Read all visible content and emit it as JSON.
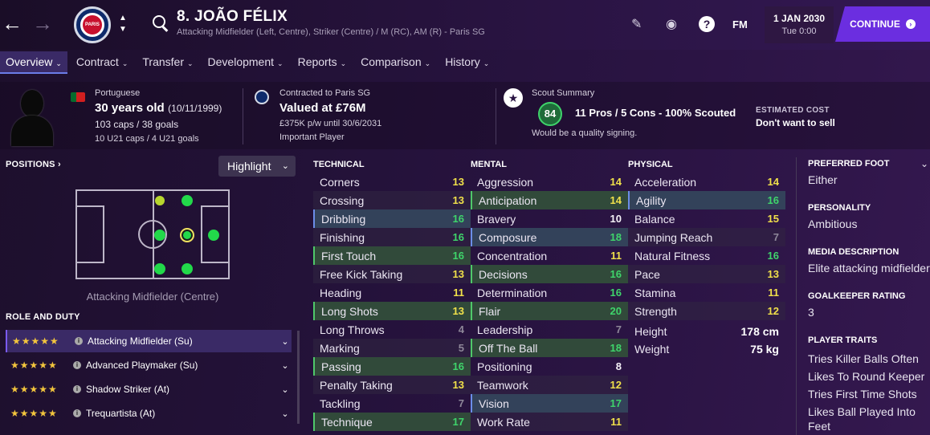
{
  "topbar": {
    "player_name": "8. JOÃO FÉLIX",
    "player_subtitle": "Attacking Midfielder (Left, Centre), Striker (Centre) / M (RC), AM (R) - Paris SG",
    "club_crest_text": "PARIS",
    "fm_label": "FM",
    "date": "1 JAN 2030",
    "time": "Tue 0:00",
    "continue_label": "CONTINUE",
    "icons": [
      "back-arrow-icon",
      "forward-arrow-icon",
      "club-crest-icon",
      "search-icon",
      "pencil-icon",
      "globe-icon",
      "help-icon"
    ]
  },
  "tabs": [
    {
      "label": "Overview",
      "active": true
    },
    {
      "label": "Contract"
    },
    {
      "label": "Transfer"
    },
    {
      "label": "Development"
    },
    {
      "label": "Reports"
    },
    {
      "label": "Comparison"
    },
    {
      "label": "History"
    }
  ],
  "info": {
    "nationality": "Portuguese",
    "age": "30 years old",
    "dob": "(10/11/1999)",
    "caps": "103 caps / 38 goals",
    "u21": "10 U21 caps / 4 U21 goals",
    "contract_label": "Contracted to Paris SG",
    "value": "Valued at £76M",
    "wage": "£375K p/w until 30/6/2031",
    "status": "Important Player",
    "scout_title": "Scout Summary",
    "scout_rating": "84",
    "scout_summary": "11 Pros / 5 Cons - 100% Scouted",
    "scout_note": "Would be a quality signing.",
    "cost_label": "ESTIMATED COST",
    "cost_value": "Don't want to sell"
  },
  "positions": {
    "title": "POSITIONS",
    "highlight_label": "Highlight",
    "position_label": "Attacking Midfielder (Centre)"
  },
  "roles": {
    "title": "ROLE AND DUTY",
    "items": [
      {
        "stars": "★★★★★",
        "name": "Attacking Midfielder (Su)"
      },
      {
        "stars": "★★★★★",
        "name": "Advanced Playmaker (Su)"
      },
      {
        "stars": "★★★★★",
        "name": "Shadow Striker (At)"
      },
      {
        "stars": "★★★★★",
        "name": "Trequartista (At)"
      }
    ]
  },
  "technical": {
    "title": "TECHNICAL",
    "attrs": [
      {
        "name": "Corners",
        "value": "13"
      },
      {
        "name": "Crossing",
        "value": "13"
      },
      {
        "name": "Dribbling",
        "value": "16"
      },
      {
        "name": "Finishing",
        "value": "16"
      },
      {
        "name": "First Touch",
        "value": "16"
      },
      {
        "name": "Free Kick Taking",
        "value": "13"
      },
      {
        "name": "Heading",
        "value": "11"
      },
      {
        "name": "Long Shots",
        "value": "13"
      },
      {
        "name": "Long Throws",
        "value": "4"
      },
      {
        "name": "Marking",
        "value": "5"
      },
      {
        "name": "Passing",
        "value": "16"
      },
      {
        "name": "Penalty Taking",
        "value": "13"
      },
      {
        "name": "Tackling",
        "value": "7"
      },
      {
        "name": "Technique",
        "value": "17"
      }
    ]
  },
  "mental": {
    "title": "MENTAL",
    "attrs": [
      {
        "name": "Aggression",
        "value": "14"
      },
      {
        "name": "Anticipation",
        "value": "14"
      },
      {
        "name": "Bravery",
        "value": "10"
      },
      {
        "name": "Composure",
        "value": "18"
      },
      {
        "name": "Concentration",
        "value": "11"
      },
      {
        "name": "Decisions",
        "value": "16"
      },
      {
        "name": "Determination",
        "value": "16"
      },
      {
        "name": "Flair",
        "value": "20"
      },
      {
        "name": "Leadership",
        "value": "7"
      },
      {
        "name": "Off The Ball",
        "value": "18"
      },
      {
        "name": "Positioning",
        "value": "8"
      },
      {
        "name": "Teamwork",
        "value": "12"
      },
      {
        "name": "Vision",
        "value": "17"
      },
      {
        "name": "Work Rate",
        "value": "11"
      }
    ]
  },
  "physical": {
    "title": "PHYSICAL",
    "attrs": [
      {
        "name": "Acceleration",
        "value": "14"
      },
      {
        "name": "Agility",
        "value": "16"
      },
      {
        "name": "Balance",
        "value": "15"
      },
      {
        "name": "Jumping Reach",
        "value": "7"
      },
      {
        "name": "Natural Fitness",
        "value": "16"
      },
      {
        "name": "Pace",
        "value": "13"
      },
      {
        "name": "Stamina",
        "value": "11"
      },
      {
        "name": "Strength",
        "value": "12"
      }
    ],
    "height_label": "Height",
    "height_value": "178 cm",
    "weight_label": "Weight",
    "weight_value": "75 kg"
  },
  "details": {
    "foot_label": "PREFERRED FOOT",
    "foot_value": "Either",
    "personality_label": "PERSONALITY",
    "personality_value": "Ambitious",
    "media_label": "MEDIA DESCRIPTION",
    "media_value": "Elite attacking midfielder",
    "gk_label": "GOALKEEPER RATING",
    "gk_value": "3",
    "traits_label": "PLAYER TRAITS",
    "traits": [
      "Tries Killer Balls Often",
      "Likes To Round Keeper",
      "Tries First Time Shots",
      "Likes Ball Played Into",
      "Feet"
    ]
  },
  "colors": {
    "accent": "#6b2ee0",
    "attr_green": "#3fd46b",
    "attr_yellow": "#f0e04a",
    "attr_white": "#f4f1f7",
    "attr_grey": "#8e8799"
  }
}
